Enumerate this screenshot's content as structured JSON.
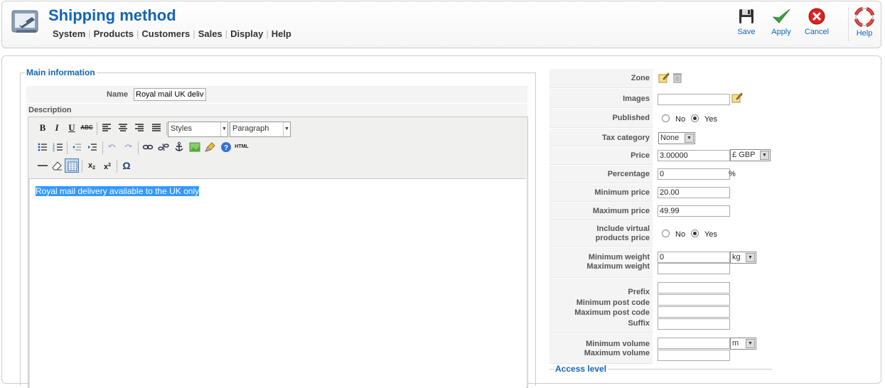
{
  "header": {
    "title": "Shipping method",
    "menu": [
      "System",
      "Products",
      "Customers",
      "Sales",
      "Display",
      "Help"
    ],
    "toolbar": {
      "save": "Save",
      "apply": "Apply",
      "cancel": "Cancel",
      "help": "Help"
    }
  },
  "main_info": {
    "legend": "Main information",
    "name_label": "Name",
    "name_value": "Royal mail UK deliver",
    "description_label": "Description",
    "editor": {
      "styles_select": "Styles",
      "format_select": "Paragraph",
      "content": "Royal mail delivery available to the UK only",
      "html_button": "HTML"
    }
  },
  "form": {
    "zone_label": "Zone",
    "images_label": "Images",
    "images_value": "",
    "published_label": "Published",
    "published_no": "No",
    "published_yes": "Yes",
    "published_value": "Yes",
    "tax_label": "Tax category",
    "tax_value": "None",
    "price_label": "Price",
    "price_value": "3.00000",
    "currency_value": "£ GBP",
    "percentage_label": "Percentage",
    "percentage_value": "0",
    "percentage_unit": "%",
    "min_price_label": "Minimum price",
    "min_price_value": "20.00",
    "max_price_label": "Maximum price",
    "max_price_value": "49.99",
    "virtual_label_1": "Include virtual",
    "virtual_label_2": "products price",
    "virtual_no": "No",
    "virtual_yes": "Yes",
    "virtual_value": "Yes",
    "min_weight_label": "Minimum weight",
    "min_weight_value": "0",
    "weight_unit": "kg",
    "max_weight_label": "Maximum weight",
    "max_weight_value": "",
    "prefix_label": "Prefix",
    "min_post_label": "Minimum post code",
    "max_post_label": "Maximum post code",
    "suffix_label": "Suffix",
    "min_volume_label": "Minimum volume",
    "volume_unit": "m",
    "max_volume_label": "Maximum volume",
    "access_legend": "Access level"
  },
  "colors": {
    "accent": "#1464b4",
    "selection": "#3399ff"
  }
}
